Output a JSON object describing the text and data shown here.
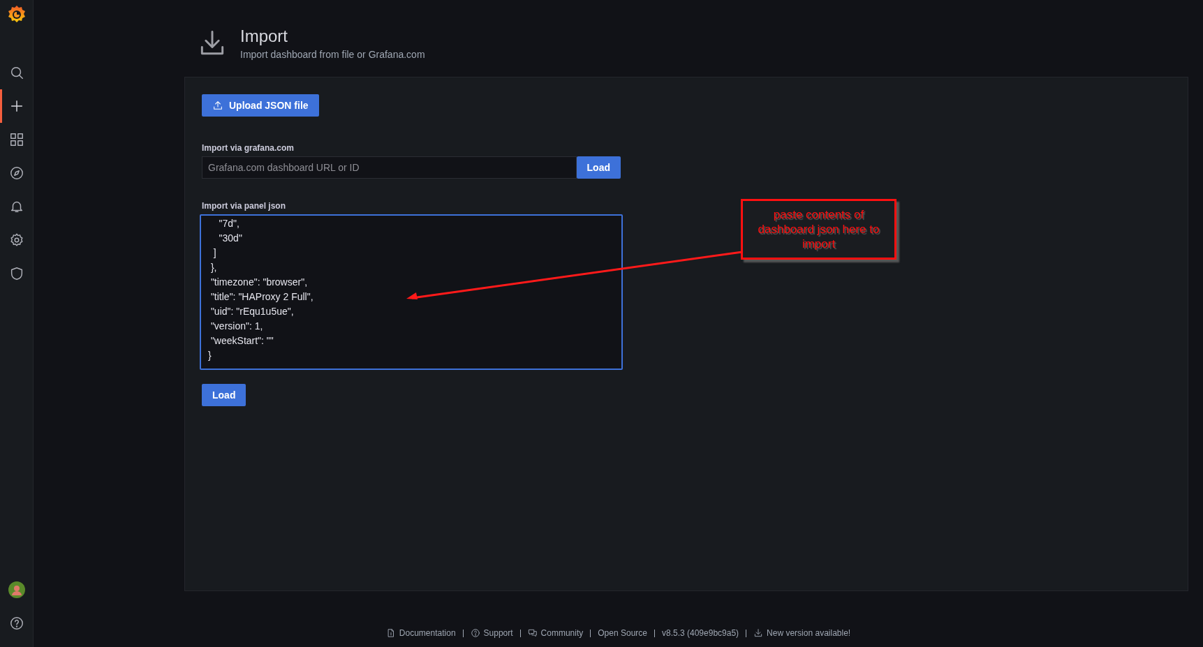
{
  "sidebar": {
    "items": [
      {
        "kind": "search",
        "selected": false
      },
      {
        "kind": "create",
        "selected": true
      },
      {
        "kind": "dashboards",
        "selected": false
      },
      {
        "kind": "explore",
        "selected": false
      },
      {
        "kind": "alerting",
        "selected": false
      },
      {
        "kind": "configuration",
        "selected": false
      },
      {
        "kind": "admin",
        "selected": false
      }
    ],
    "bottom": [
      {
        "kind": "avatar"
      },
      {
        "kind": "help"
      }
    ]
  },
  "header": {
    "title": "Import",
    "subtitle": "Import dashboard from file or Grafana.com"
  },
  "upload_button": "Upload JSON file",
  "grafana_import": {
    "label": "Import via grafana.com",
    "placeholder": "Grafana.com dashboard URL or ID",
    "button": "Load"
  },
  "json_import": {
    "label": "Import via panel json",
    "value": "    \"7d\",\n    \"30d\"\n  ]\n },\n \"timezone\": \"browser\",\n \"title\": \"HAProxy 2 Full\",\n \"uid\": \"rEqu1u5ue\",\n \"version\": 1,\n \"weekStart\": \"\"\n}"
  },
  "load_button": "Load",
  "annotation": {
    "text": "paste contents of dashboard json here to import"
  },
  "footer": [
    {
      "kind": "doc",
      "label": "Documentation"
    },
    {
      "kind": "help",
      "label": "Support"
    },
    {
      "kind": "chat",
      "label": "Community"
    },
    {
      "kind": "none",
      "label": "Open Source"
    },
    {
      "kind": "none",
      "label": "v8.5.3 (409e9bc9a5)"
    },
    {
      "kind": "download",
      "label": "New version available!"
    }
  ]
}
